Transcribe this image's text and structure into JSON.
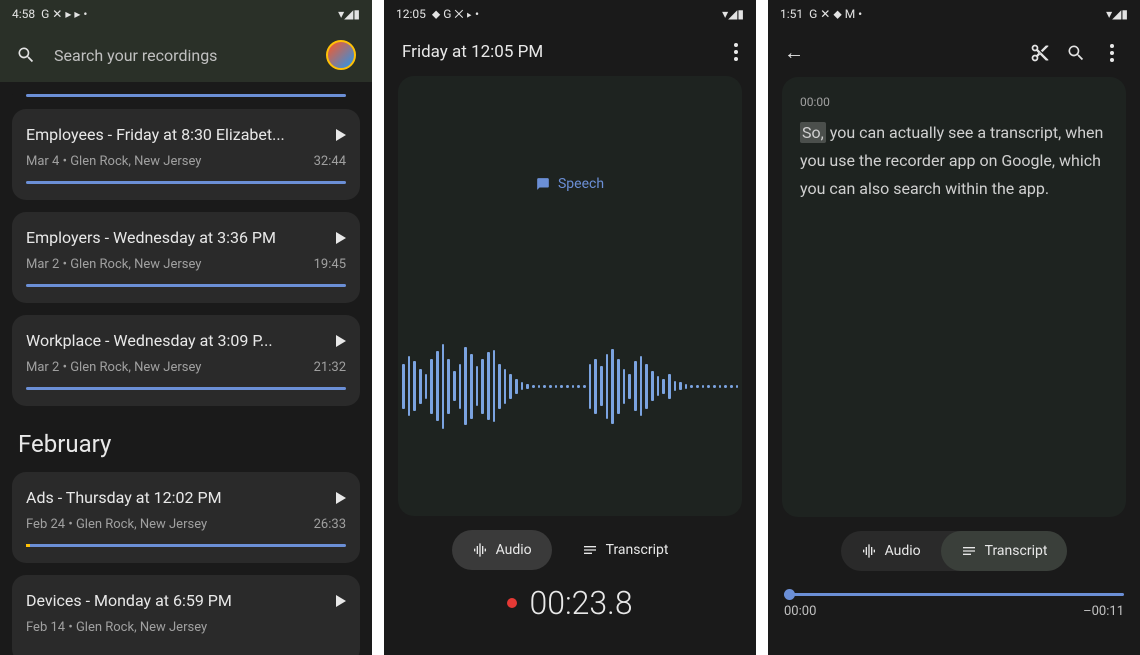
{
  "screen1": {
    "status_time": "4:58",
    "search_placeholder": "Search your recordings",
    "recordings": [
      {
        "title": "Employees - Friday at 8:30 Elizabet...",
        "date": "Mar 4",
        "location": "Glen Rock, New Jersey",
        "duration": "32:44"
      },
      {
        "title": "Employers - Wednesday at 3:36 PM",
        "date": "Mar 2",
        "location": "Glen Rock, New Jersey",
        "duration": "19:45"
      },
      {
        "title": "Workplace - Wednesday at 3:09 P...",
        "date": "Mar 2",
        "location": "Glen Rock, New Jersey",
        "duration": "21:32"
      }
    ],
    "month_divider": "February",
    "recordings_feb": [
      {
        "title": "Ads - Thursday at 12:02 PM",
        "date": "Feb 24",
        "location": "Glen Rock, New Jersey",
        "duration": "26:33"
      },
      {
        "title": "Devices - Monday at 6:59 PM",
        "date": "Feb 14",
        "location": "Glen Rock, New Jersey",
        "duration": ""
      }
    ]
  },
  "screen2": {
    "status_time": "12:05",
    "title": "Friday at 12:05 PM",
    "badge": "Speech",
    "audio_label": "Audio",
    "transcript_label": "Transcript",
    "timer": "00:23.8"
  },
  "screen3": {
    "status_time": "1:51",
    "ts_time": "00:00",
    "ts_highlight": "So,",
    "ts_body": " you can actually see a transcript, when you use the recorder app on Google, which you can also search within the app.",
    "audio_label": "Audio",
    "transcript_label": "Transcript",
    "time_start": "00:00",
    "time_end": "–00:11"
  }
}
